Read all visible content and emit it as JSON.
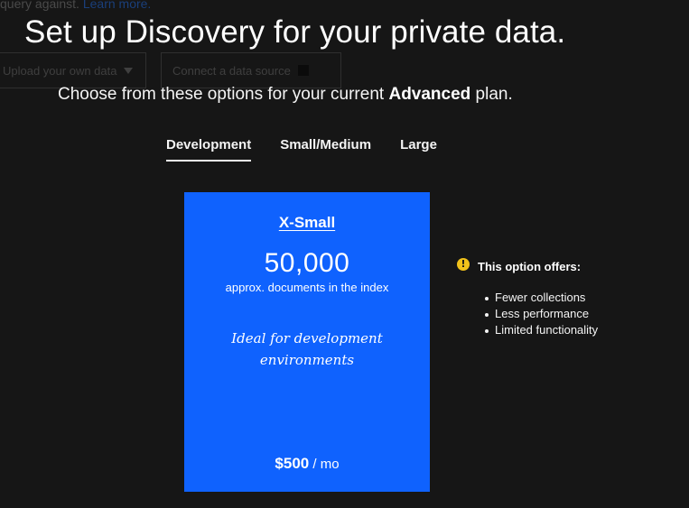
{
  "background": {
    "text": "query against.",
    "link": "Learn more.",
    "button_one": "Upload your own data",
    "button_two": "Connect a data source"
  },
  "title": "Set up Discovery for your private data.",
  "subtitle": {
    "prefix": "Choose from these options for your current ",
    "plan": "Advanced",
    "suffix": " plan."
  },
  "tabs": [
    {
      "label": "Development",
      "active": true
    },
    {
      "label": "Small/Medium",
      "active": false
    },
    {
      "label": "Large",
      "active": false
    }
  ],
  "card": {
    "name": "X-Small",
    "count": "50,000",
    "count_label": "approx. documents in the index",
    "ideal": "Ideal for development environments",
    "price": "$500",
    "price_unit": " / mo",
    "color": "#0f62fe"
  },
  "info": {
    "icon": "warning-icon",
    "heading": "This option offers:",
    "items": [
      "Fewer collections",
      "Less performance",
      "Limited functionality"
    ],
    "icon_color": "#f1c21b"
  }
}
